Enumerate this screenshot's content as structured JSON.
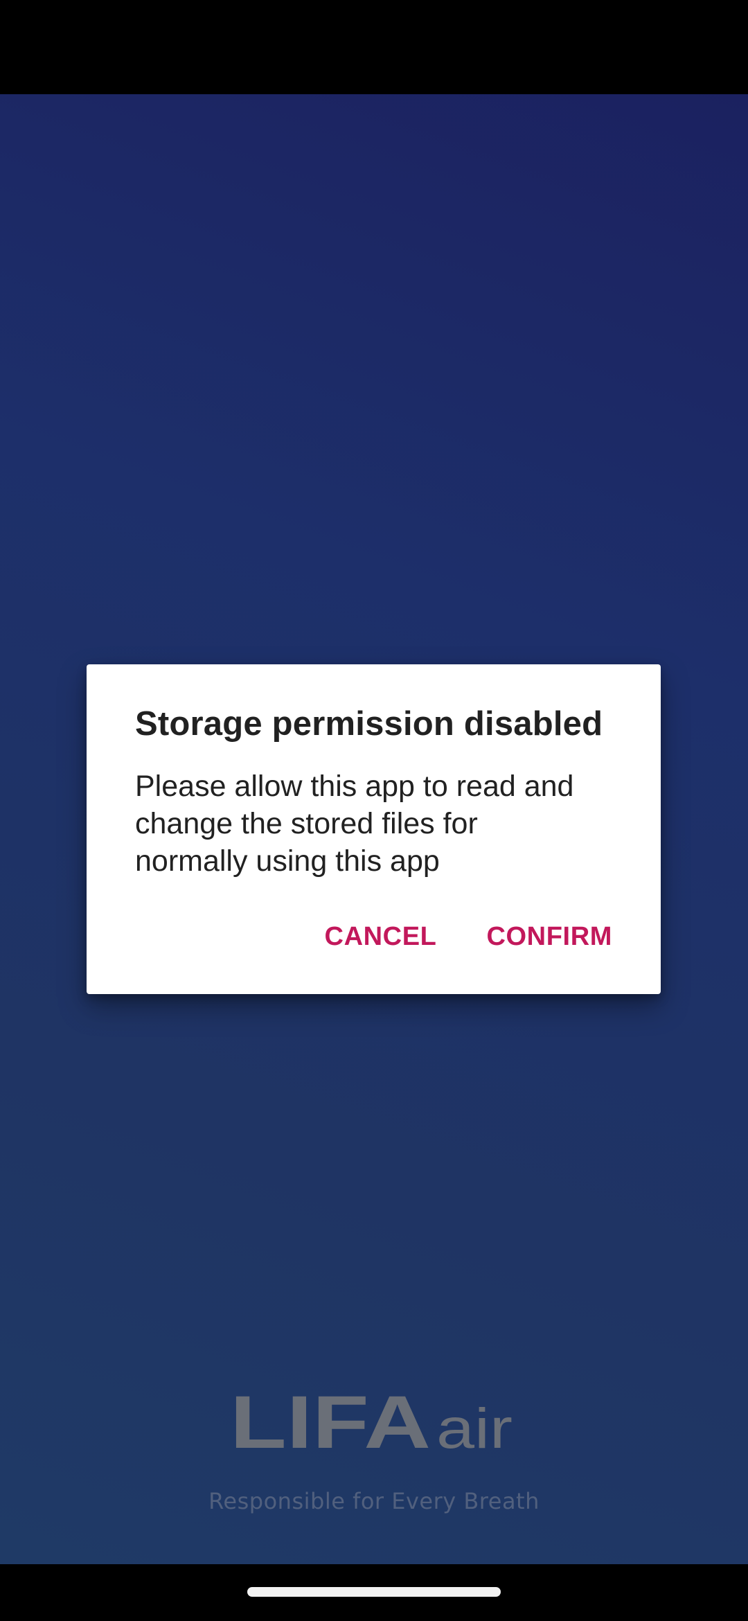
{
  "dialog": {
    "title": "Storage permission disabled",
    "message": "Please allow this app to read and change the stored files for normally using this app",
    "cancel_label": "CANCEL",
    "confirm_label": "CONFIRM"
  },
  "branding": {
    "logo_text_bold": "LIFA",
    "logo_text_light": "air",
    "tagline": "Responsible for Every Breath"
  },
  "colors": {
    "accent": "#c2185b",
    "background_top": "#1b2160",
    "background_bottom": "#1f3a66",
    "logo_gray": "#6a6f78"
  }
}
